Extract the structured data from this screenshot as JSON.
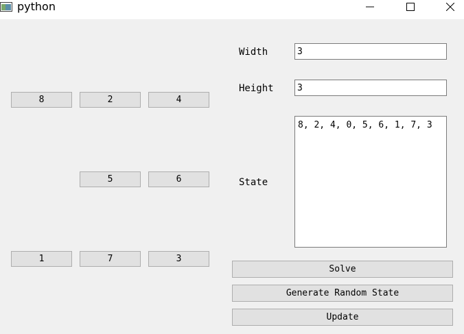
{
  "window": {
    "title": "python"
  },
  "puzzle": {
    "tiles": [
      {
        "label": "8",
        "pos": 0
      },
      {
        "label": "2",
        "pos": 1
      },
      {
        "label": "4",
        "pos": 2
      },
      {
        "label": "5",
        "pos": 4
      },
      {
        "label": "6",
        "pos": 5
      },
      {
        "label": "1",
        "pos": 6
      },
      {
        "label": "7",
        "pos": 7
      },
      {
        "label": "3",
        "pos": 8
      }
    ]
  },
  "form": {
    "width_label": "Width",
    "width_value": "3",
    "height_label": "Height",
    "height_value": "3",
    "state_label": "State",
    "state_value": "8, 2, 4, 0, 5, 6, 1, 7, 3"
  },
  "actions": {
    "solve": "Solve",
    "generate": "Generate Random State",
    "update": "Update"
  },
  "icons": {
    "app": "python-window-icon",
    "minimize": "minimize-icon",
    "maximize": "maximize-icon",
    "close": "close-icon"
  }
}
